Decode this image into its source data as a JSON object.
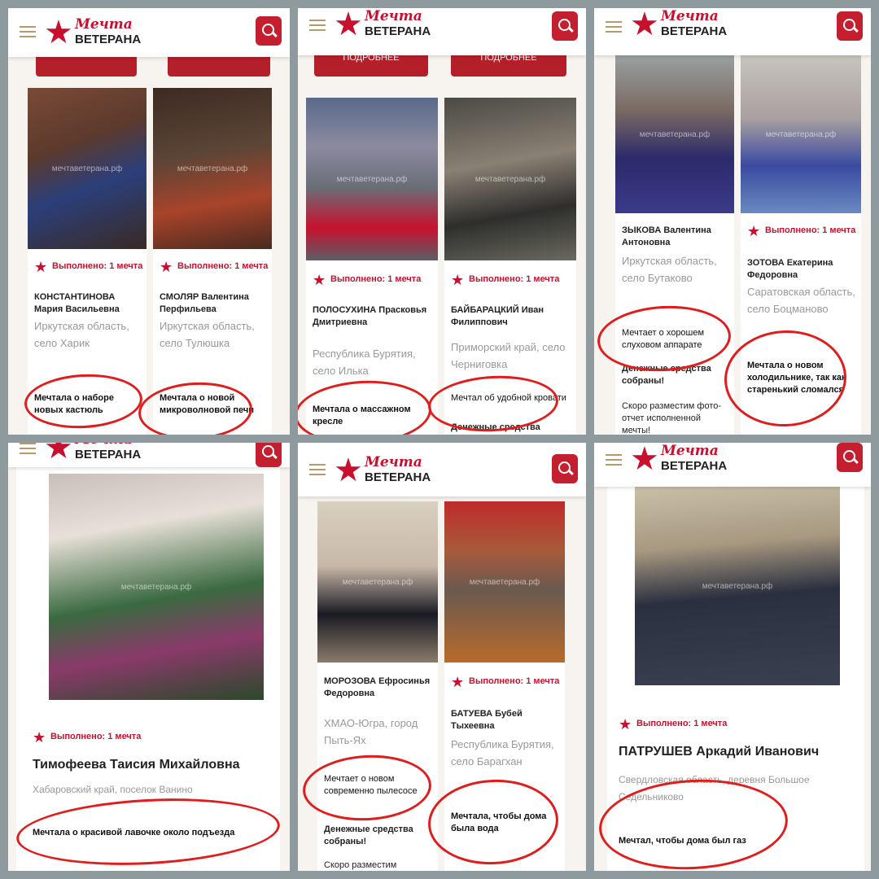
{
  "brand": {
    "line1": "Мечта",
    "line2": "ВЕТЕРАНА",
    "star": "★"
  },
  "status": "Выполнено: 1 мечта",
  "watermark": "мечтаветерана.рф",
  "more_button": "ПОДРОБНЕЕ",
  "funds": "Денежные средства собраны!",
  "report": "Скоро разместим фото-отчет исполненной мечты!",
  "report_short": "Скоро разместим",
  "funds_cut": "Денежные средства",
  "panels": {
    "p1": {
      "a": {
        "name": "КОНСТАНТИНОВА Мария Васильевна",
        "location": "Иркутская область, село Харик",
        "dream": "Мечтала о наборе новых кастюль"
      },
      "b": {
        "name": "СМОЛЯР Валентина Перфильева",
        "location": "Иркутская область, село Тулюшка",
        "dream": "Мечтала о новой микроволновой печи"
      }
    },
    "p2": {
      "a": {
        "name": "ПОЛОСУХИНА Прасковья Дмитриевна",
        "location": "Республика Бурятия, село Илька",
        "dream": "Мечтала о массажном кресле"
      },
      "b": {
        "name": "БАЙБАРАЦКИЙ Иван Филиппович",
        "location": "Приморский край, село Черниговка",
        "dream": "Мечтал об удобной кровати"
      }
    },
    "p3": {
      "a": {
        "name": "ЗЫКОВА Валентина Антоновна",
        "location": "Иркутская область, село Бутаково",
        "dream": "Мечтает о хорошем слуховом аппарате"
      },
      "b": {
        "name": "ЗОТОВА Екатерина Федоровна",
        "location": "Саратовская область, село Боцманово",
        "dream": "Мечтала о новом холодильнике, так как старенький сломался"
      }
    },
    "p4": {
      "name": "Тимофеева Таисия Михайловна",
      "location": "Хабаровский край, поселок Ванино",
      "dream": "Мечтала о красивой лавочке около подъезда"
    },
    "p5": {
      "a": {
        "name": "МОРОЗОВА Ефросинья Федоровна",
        "location": "ХМАО-Югра, город Пыть-Ях",
        "dream": "Мечтает о новом современно пылесосе"
      },
      "b": {
        "name": "БАТУЕВА Бубей Тыхеевна",
        "location": "Республика Бурятия, село Барагхан",
        "dream": "Мечтала, чтобы дома была вода"
      }
    },
    "p6": {
      "name": "ПАТРУШЕВ Аркадий Иванович",
      "location": "Свердловская область, деревня Большое Седельниково",
      "dream": "Мечтал, чтобы дома был газ"
    }
  }
}
